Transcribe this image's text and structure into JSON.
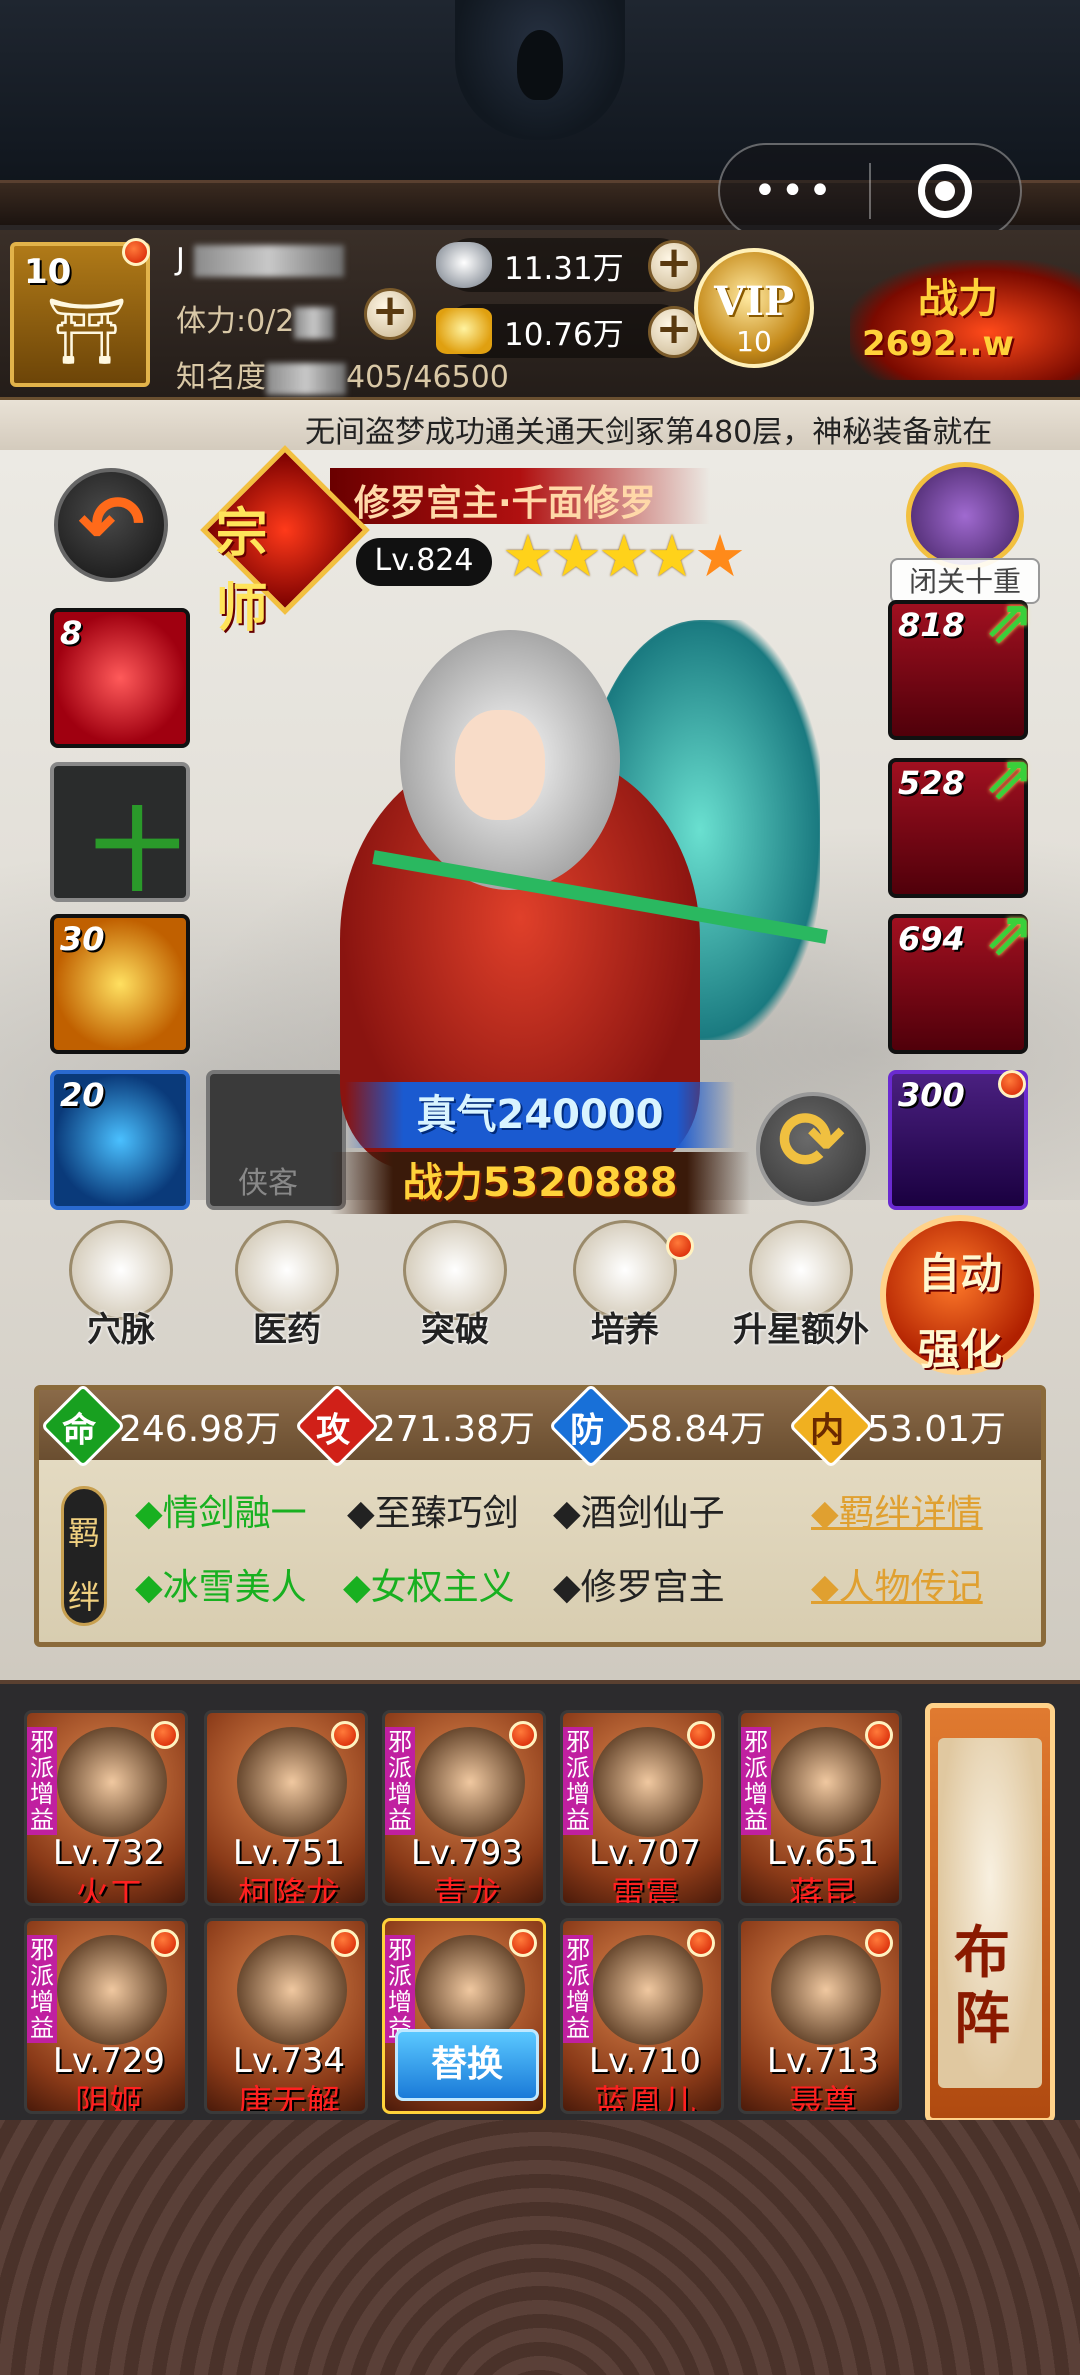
{
  "mini_program": {
    "menu_dots": "•••"
  },
  "player": {
    "level": "10",
    "name_prefix": "J",
    "stamina_label": "体力:0/2",
    "fame_label": "知名度",
    "fame_value": "405/46500",
    "silver": "11.31万",
    "gold": "10.76万",
    "vip_label": "VIP",
    "vip_level": "10",
    "power_label": "战力",
    "power_value": "2692..w"
  },
  "marquee": "无间盗梦成功通关通天剑冢第480层，神秘装备就在",
  "hero": {
    "rank": "宗师",
    "name": "修罗宫主·千面修罗",
    "level": "Lv.824",
    "stars_filled": 4,
    "stars_total": 5,
    "seclusion": "闭关十重",
    "qi": "真气240000",
    "power": "战力5320888"
  },
  "left_slots": [
    {
      "count": "8",
      "type": "rose"
    },
    {
      "count": "",
      "type": "add",
      "symbol": "十"
    },
    {
      "count": "30",
      "type": "fire"
    },
    {
      "count": "20",
      "type": "eye"
    }
  ],
  "empty_slot_label": "侠客",
  "right_slots": [
    {
      "count": "818",
      "item": "sword-icon"
    },
    {
      "count": "528",
      "item": "robe-icon"
    },
    {
      "count": "694",
      "item": "token-icon"
    },
    {
      "count": "300",
      "item": "dragon-icon"
    }
  ],
  "functions": [
    "穴脉",
    "医药",
    "突破",
    "培养",
    "升星额外"
  ],
  "auto_button": [
    "自动",
    "强化"
  ],
  "stats": [
    {
      "icon": "命",
      "value": "246.98万"
    },
    {
      "icon": "攻",
      "value": "271.38万"
    },
    {
      "icon": "防",
      "value": "58.84万"
    },
    {
      "icon": "内",
      "value": "53.01万"
    }
  ],
  "bond_tag": [
    "羁",
    "绊"
  ],
  "bonds_row1": [
    {
      "text": "◆情剑融一",
      "active": true
    },
    {
      "text": "◆至臻巧剑",
      "active": false
    },
    {
      "text": "◆酒剑仙子",
      "active": false
    }
  ],
  "bonds_row2": [
    {
      "text": "◆冰雪美人",
      "active": true
    },
    {
      "text": "◆女权主义",
      "active": true
    },
    {
      "text": "◆修罗宫主",
      "active": false
    }
  ],
  "bond_links": [
    "◆羁绊详情",
    "◆人物传记"
  ],
  "roster": [
    {
      "lv": "Lv.732",
      "name": "火工",
      "sect": "邪派增益"
    },
    {
      "lv": "Lv.751",
      "name": "柯降龙",
      "sect": ""
    },
    {
      "lv": "Lv.793",
      "name": "青龙",
      "sect": "邪派增益"
    },
    {
      "lv": "Lv.707",
      "name": "雷震",
      "sect": "邪派增益"
    },
    {
      "lv": "Lv.651",
      "name": "蒋昆",
      "sect": "邪派增益"
    },
    {
      "lv": "Lv.729",
      "name": "阴姬",
      "sect": "邪派增益"
    },
    {
      "lv": "Lv.734",
      "name": "唐无解",
      "sect": ""
    },
    {
      "lv": "",
      "name": "",
      "sect": "邪派增益",
      "replace": "替换"
    },
    {
      "lv": "Lv.710",
      "name": "蓝凰儿",
      "sect": "邪派增益"
    },
    {
      "lv": "Lv.713",
      "name": "聂尊",
      "sect": ""
    }
  ],
  "deploy": [
    "布",
    "阵"
  ]
}
